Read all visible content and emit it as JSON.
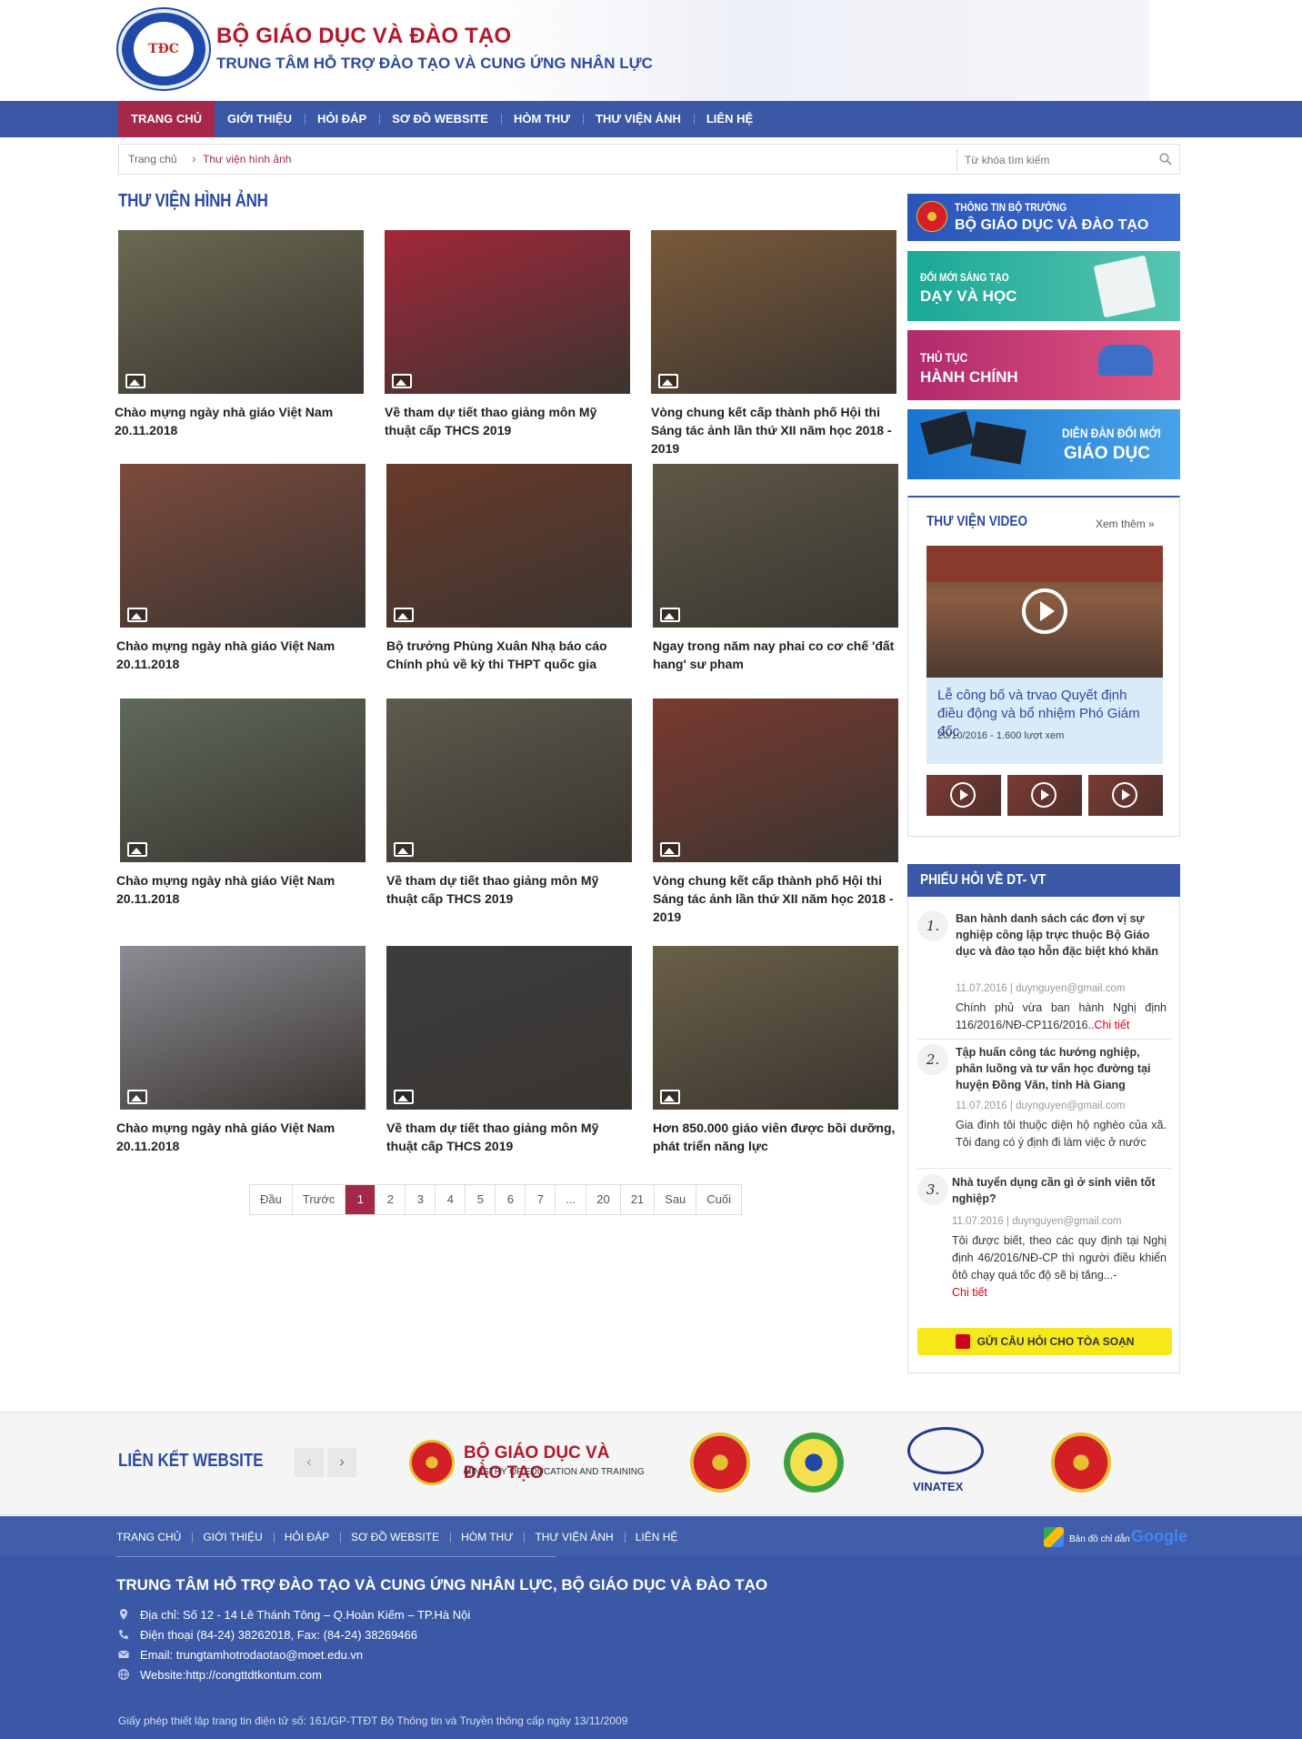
{
  "header": {
    "logo_text": "TĐC",
    "brand_line1": "BỘ GIÁO DỤC VÀ ĐÀO TẠO",
    "brand_line2": "TRUNG TÂM HỖ TRỢ ĐÀO TẠO VÀ CUNG ỨNG NHÂN LỰC"
  },
  "nav": {
    "items": [
      "TRANG CHỦ",
      "GIỚI THIỆU",
      "HỎI ĐÁP",
      "SƠ ĐỒ WEBSITE",
      "HÒM THƯ",
      "THƯ VIỆN ẢNH",
      "LIÊN HỆ"
    ],
    "active_index": 0
  },
  "breadcrumb": {
    "home": "Trang chủ",
    "separator": "›",
    "current": "Thư viện hình ảnh"
  },
  "search": {
    "placeholder": "Từ khóa tìm kiếm"
  },
  "gallery": {
    "title": "THƯ VIỆN HÌNH ẢNH",
    "items": [
      {
        "caption": "Chào mựng ngày nhà giáo Việt Nam 20.11.2018",
        "tone": "#6b6a52"
      },
      {
        "caption": "Về tham dự tiết thao giảng môn Mỹ thuật cấp THCS 2019",
        "tone": "#a3273a"
      },
      {
        "caption": "Vòng chung kết cấp thành phố Hội thi Sáng tác ảnh lần thứ XII năm học 2018 - 2019",
        "tone": "#7a5a3a"
      },
      {
        "caption": "Chào mựng ngày nhà giáo Việt Nam 20.11.2018",
        "tone": "#7d4a3d"
      },
      {
        "caption": "Bộ trưởng Phùng Xuân Nhạ báo cáo Chính phủ về kỳ thi THPT quốc gia",
        "tone": "#6a3a2a"
      },
      {
        "caption": "Ngay trong năm nay phai co cơ chế 'đất hang' sư pham",
        "tone": "#5d5846"
      },
      {
        "caption": "Chào mựng ngày nhà giáo Việt Nam 20.11.2018",
        "tone": "#5f6a5a"
      },
      {
        "caption": "Về tham dự tiết thao giảng môn Mỹ thuật cấp THCS 2019",
        "tone": "#5e5a4c"
      },
      {
        "caption": "Vòng chung kết cấp thành phố Hội thi Sáng tác ảnh lần thứ XII năm học 2018 - 2019",
        "tone": "#7a3a30"
      },
      {
        "caption": "Chào mựng ngày nhà giáo Việt Nam 20.11.2018",
        "tone": "#8d8c95"
      },
      {
        "caption": "Về tham dự tiết thao giảng môn Mỹ thuật cấp THCS 2019",
        "tone": "#3c3c40"
      },
      {
        "caption": "Hơn 850.000 giáo viên được bồi dưỡng, phát triển năng lực",
        "tone": "#6b6048"
      }
    ]
  },
  "pagination": {
    "items": [
      "Đầu",
      "Trước",
      "1",
      "2",
      "3",
      "4",
      "5",
      "6",
      "7",
      "...",
      "20",
      "21",
      "Sau",
      "Cuối"
    ],
    "active": "1"
  },
  "sidebar": {
    "banners": [
      {
        "line1": "THÔNG TIN BỘ TRƯỞNG",
        "line2": "BỘ GIÁO DỤC VÀ ĐÀO TẠO"
      },
      {
        "line1": "ĐỔI MỚI SÁNG TẠO",
        "line2": "DẠY VÀ HỌC"
      },
      {
        "line1": "THỦ TỤC",
        "line2": "HÀNH CHÍNH"
      },
      {
        "line1": "DIỄN ĐÀN ĐỔI MỚI",
        "line2": "GIÁO DỤC"
      }
    ],
    "video": {
      "title": "THƯ VIỆN VIDEO",
      "more": "Xem thêm »",
      "caption": "Lễ công bố và trvao Quyết định điều động và bổ nhiệm Phó Giám đốc",
      "meta": "20/10/2016 - 1.600 lượt xem"
    },
    "faq": {
      "title": "PHIẾU HỎI VỀ DT- VT",
      "items": [
        {
          "num": "1.",
          "title": "Ban hành danh sách các đơn vị sự nghiệp công lập trực thuộc Bộ Giáo dục và đào tạo hỗn đặc biệt khó khăn",
          "meta": "11.07.2016  |   duynguyen@gmail.com",
          "desc": "Chính phủ vừa ban hành Nghị định 116/2016/NĐ-CP116/2016..",
          "more": "Chi tiết"
        },
        {
          "num": "2.",
          "title": "Tập huấn công tác hướng nghiệp, phân luồng và tư vấn học đường tại huyện Đồng Văn, tỉnh Hà Giang",
          "meta": "11.07.2016  |   duynguyen@gmail.com",
          "desc": "Gia đình tôi thuộc diện hộ nghèo của xã. Tôi đang có ý định đi làm việc ở nước",
          "more": ""
        },
        {
          "num": "3.",
          "title": "Nhà tuyển dụng cần gì ở sinh viên tốt nghiệp?",
          "meta": "11.07.2016  |   duynguyen@gmail.com",
          "desc": "Tôi được biết, theo các quy định tại Nghị định 46/2016/NĐ-CP thì người điều khiển ôtô chạy quá tốc độ sẽ bị tăng...-",
          "more": "Chi tiết"
        }
      ],
      "ask_button": "GỬI CÂU HỎI CHO TÒA SOẠN"
    }
  },
  "links": {
    "title": "LIÊN KẾT WEBSITE",
    "prev": "‹",
    "next": "›",
    "moet_name": "BỘ GIÁO DỤC VÀ ĐÀO TẠO",
    "moet_en": "MINISTRY OF EDUCATION AND TRAINING",
    "vinatex": "VINATEX"
  },
  "footer": {
    "nav": [
      "TRANG CHỦ",
      "GIỚI THIỆU",
      "HỎI ĐÁP",
      "SƠ ĐỒ WEBSITE",
      "HÒM THƯ",
      "THƯ VIỆN ẢNH",
      "LIÊN HỆ"
    ],
    "map_label": "Bản đồ chỉ dẫn",
    "map_brand": "Google",
    "org": "TRUNG TÂM HỖ TRỢ ĐÀO TẠO VÀ CUNG ỨNG NHÂN LỰC, BỘ GIÁO DỤC VÀ ĐÀO TẠO",
    "address": "Địa chỉ: Số 12 - 14 Lê Thánh Tông – Q.Hoàn Kiếm – TP.Hà Nội",
    "phone": "Điện thoại (84-24) 38262018, Fax: (84-24) 38269466",
    "email": "Email: trungtamhotrodaotao@moet.edu.vn",
    "website": "Website:http://congttdtkontum.com",
    "license": "Giấy phép thiết lập trang tin điện tử số: 161/GP-TTĐT Bộ Thông tin và Truyền thông cấp ngày 13/11/2009"
  },
  "colors": {
    "brand_blue": "#3a58a5",
    "brand_red": "#a5274a",
    "title_blue": "#2c4aa0",
    "ask_yellow": "#f7e81c"
  }
}
